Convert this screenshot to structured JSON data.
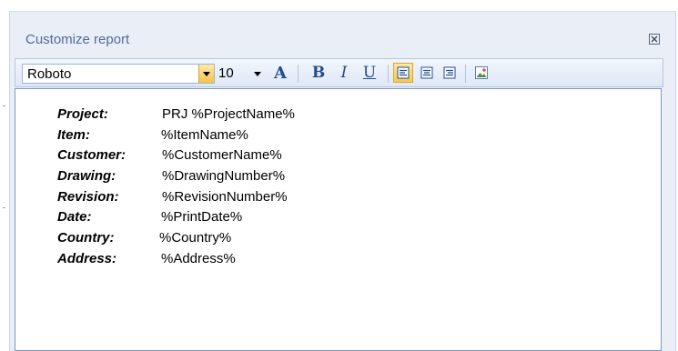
{
  "dialog": {
    "title": "Customize report",
    "close_icon": "close-icon"
  },
  "toolbar": {
    "font_family": "Roboto",
    "font_size": "10",
    "font_color_glyph": "A",
    "bold_glyph": "B",
    "italic_glyph": "I",
    "underline_glyph": "U",
    "icons": [
      "font-dropdown-icon",
      "size-dropdown-icon",
      "font-color-icon",
      "bold-icon",
      "italic-icon",
      "underline-icon",
      "align-left-icon",
      "align-center-icon",
      "align-right-icon",
      "insert-image-icon"
    ],
    "active_alignment": "left",
    "accent_color": "#204d8f",
    "active_bg_color": "#f8c84c"
  },
  "report_fields": [
    {
      "label": "Project:",
      "value": "PRJ %ProjectName%"
    },
    {
      "label": "Item:",
      "value": "%ItemName%"
    },
    {
      "label": "Customer:",
      "value": "%CustomerName%"
    },
    {
      "label": "Drawing:",
      "value": "%DrawingNumber%"
    },
    {
      "label": "Revision:",
      "value": "%RevisionNumber%"
    },
    {
      "label": "Date:",
      "value": "%PrintDate%"
    },
    {
      "label": "Country:",
      "value": "%Country%"
    },
    {
      "label": "Address:",
      "value": "%Address%"
    }
  ]
}
